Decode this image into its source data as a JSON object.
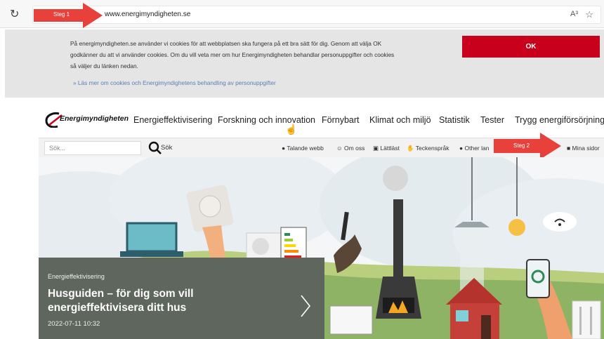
{
  "browser": {
    "url": "www.energimyndigheten.se",
    "reload_icon": "reload-icon",
    "read_aloud_label": "A³",
    "favorites_icon": "add-favorite-icon"
  },
  "annotations": {
    "step1": "Steg 1",
    "step2": "Steg 2",
    "arrow_color": "#e8403a"
  },
  "cookie_banner": {
    "text": "På energimyndigheten.se använder vi cookies för att webbplatsen ska fungera på ett bra sätt för dig. Genom att välja OK godkänner du att vi använder cookies. Om du vill veta mer om hur Energimyndigheten behandlar personuppgifter och cookies så väljer du länken nedan.",
    "link": "» Läs mer om cookies och Energimyndighetens behandling av personuppgifter",
    "ok_label": "OK",
    "ok_color": "#c8001c"
  },
  "header": {
    "logo_text": "Energimyndigheten",
    "nav": [
      "Energieffektivisering",
      "Forskning och innovation",
      "Förnybart",
      "Klimat och miljö",
      "Statistik",
      "Tester",
      "Trygg energiförsörjning"
    ]
  },
  "toolbar": {
    "search_placeholder": "Sök...",
    "search_label": "Sök",
    "links": [
      "Talande webb",
      "Om oss",
      "Lättläst",
      "Teckenspråk",
      "Other lan",
      "Mina sidor"
    ]
  },
  "hero": {
    "category": "Energieffektivisering",
    "title": "Husguiden – för dig som vill energieffektivisera ditt hus",
    "date": "2022-07-11 10:32"
  }
}
